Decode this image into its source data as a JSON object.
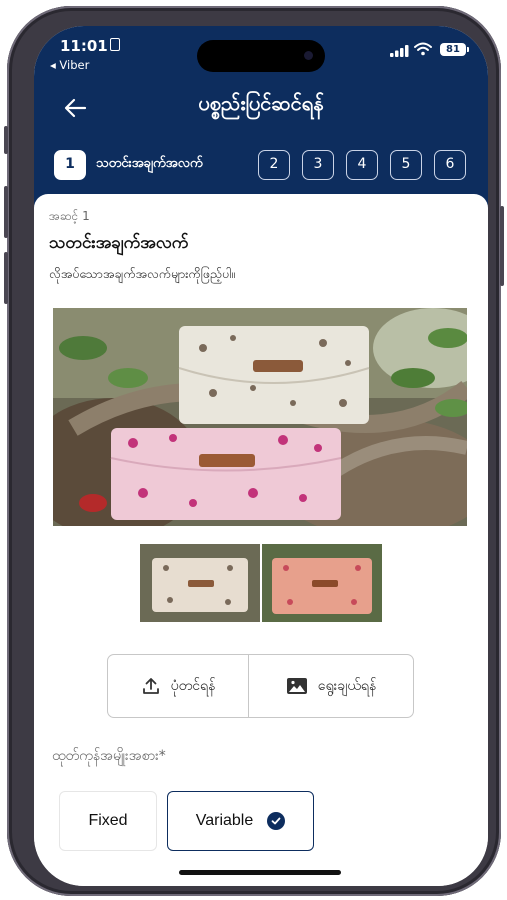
{
  "status_bar": {
    "time": "11:01",
    "back_app": "◂ Viber",
    "battery": "81"
  },
  "header": {
    "title": "ပစ္စည်းပြင်ဆင်ရန်"
  },
  "stepper": {
    "steps": [
      "1",
      "2",
      "3",
      "4",
      "5",
      "6"
    ],
    "active_step": "1",
    "active_label": "သတင်းအချက်အလက်"
  },
  "section": {
    "step_number": "အဆင့် 1",
    "title": "သတင်းအချက်အလက်",
    "description": "လိုအပ်သောအချက်အလက်များကိုဖြည့်ပါ။"
  },
  "images": {
    "main_photo": "handmade pouches photo",
    "thumbnail_count": 2
  },
  "actions": {
    "upload_label": "ပုံတင်ရန်",
    "select_label": "ရွေးချယ်ရန်"
  },
  "product_type": {
    "label": "ထုတ်ကုန်အမျိုးအစား",
    "required_mark": "*",
    "options": [
      "Fixed",
      "Variable"
    ],
    "selected": "Variable"
  },
  "colors": {
    "header_bg": "#0d2d5e",
    "accent": "#0d2d5e"
  }
}
